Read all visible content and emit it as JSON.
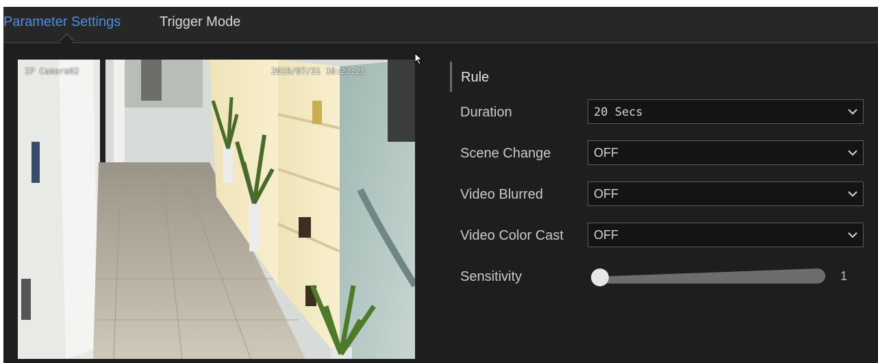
{
  "tabs": [
    {
      "label": "Parameter Settings",
      "active": true
    },
    {
      "label": "Trigger Mode",
      "active": false
    }
  ],
  "preview": {
    "camera_name": "IP Camera02",
    "timestamp": "2019/07/31 16:23:25"
  },
  "rule": {
    "title": "Rule",
    "fields": [
      {
        "label": "Duration",
        "value": "20 Secs"
      },
      {
        "label": "Scene Change",
        "value": "OFF"
      },
      {
        "label": "Video Blurred",
        "value": "OFF"
      },
      {
        "label": "Video Color Cast",
        "value": "OFF"
      }
    ],
    "sensitivity": {
      "label": "Sensitivity",
      "value": "1"
    }
  },
  "colors": {
    "background": "#1e1e1f",
    "tab_active": "#4d8fe0",
    "text": "#c9c9c9",
    "select_bg": "#141415"
  }
}
